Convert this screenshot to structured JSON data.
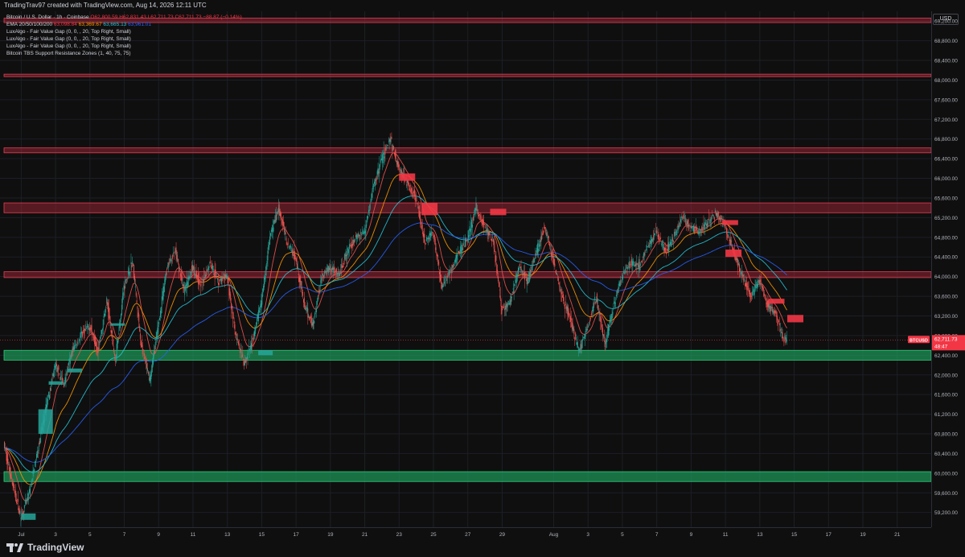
{
  "header": {
    "caption": "TradingTrav97 created with TradingView.com, Aug 14, 2026 12:11 UTC"
  },
  "legend": {
    "symbol_line": {
      "name": "Bitcoin / U.S. Dollar · 1h · Coinbase",
      "ohlc": "O62,800.59  H62,831.43  L62,711.73  C62,711.73  −88.87 (−0.14%)"
    },
    "ema_line": {
      "name": "EMA 20/50/100/200",
      "v20": "63,098.84",
      "v50": "63,369.67",
      "v100": "63,665.13",
      "v200": "63,961.01"
    },
    "indicators": [
      "LuxAlgo - Fair Value Gap (0, 0, , 20, Top Right, Small)",
      "LuxAlgo - Fair Value Gap (0, 0, , 20, Top Right, Small)",
      "LuxAlgo - Fair Value Gap (0, 0, , 20, Top Right, Small)",
      "Bitcoin TBS Support Resistance Zones (1, 40, 75, 75)"
    ]
  },
  "currency_button": "USD",
  "footer": {
    "brand": "TradingView"
  },
  "colors": {
    "background": "#0f0f0f",
    "up": "#26a69a",
    "down": "#ef5350",
    "resistance_zone": "#b2283a",
    "support_zone": "#1e9a5a",
    "ema20": "#ef5350",
    "ema50": "#ff9800",
    "ema100": "#26c6da",
    "ema200": "#2962ff",
    "price_tag": "#f23645"
  },
  "chart_data": {
    "type": "candlestick",
    "symbol": "BTCUSD",
    "timeframe": "1h",
    "ylim": [
      58900,
      69400
    ],
    "y_ticks": [
      "69,200.00",
      "68,800.00",
      "68,400.00",
      "68,000.00",
      "67,600.00",
      "67,200.00",
      "66,800.00",
      "66,400.00",
      "66,000.00",
      "65,600.00",
      "65,200.00",
      "64,800.00",
      "64,400.00",
      "64,000.00",
      "63,600.00",
      "63,200.00",
      "62,800.00",
      "62,400.00",
      "62,000.00",
      "61,600.00",
      "61,200.00",
      "60,800.00",
      "60,400.00",
      "60,000.00",
      "59,600.00",
      "59,200.00"
    ],
    "y_tick_values": [
      69200,
      68800,
      68400,
      68000,
      67600,
      67200,
      66800,
      66400,
      66000,
      65600,
      65200,
      64800,
      64400,
      64000,
      63600,
      63200,
      62800,
      62400,
      62000,
      61600,
      61200,
      60800,
      60400,
      60000,
      59600,
      59200
    ],
    "x_range_days": [
      0,
      52
    ],
    "x_ticks": [
      {
        "label": "Jul",
        "day": 1
      },
      {
        "label": "3",
        "day": 3
      },
      {
        "label": "5",
        "day": 5
      },
      {
        "label": "7",
        "day": 7
      },
      {
        "label": "9",
        "day": 9
      },
      {
        "label": "11",
        "day": 11
      },
      {
        "label": "13",
        "day": 13
      },
      {
        "label": "15",
        "day": 15
      },
      {
        "label": "17",
        "day": 17
      },
      {
        "label": "19",
        "day": 19
      },
      {
        "label": "21",
        "day": 21
      },
      {
        "label": "23",
        "day": 23
      },
      {
        "label": "25",
        "day": 25
      },
      {
        "label": "27",
        "day": 27
      },
      {
        "label": "29",
        "day": 29
      },
      {
        "label": "Aug",
        "day": 32
      },
      {
        "label": "3",
        "day": 34
      },
      {
        "label": "5",
        "day": 36
      },
      {
        "label": "7",
        "day": 38
      },
      {
        "label": "9",
        "day": 40
      },
      {
        "label": "11",
        "day": 42
      },
      {
        "label": "13",
        "day": 44
      },
      {
        "label": "15",
        "day": 46
      },
      {
        "label": "17",
        "day": 48
      },
      {
        "label": "19",
        "day": 50
      },
      {
        "label": "21",
        "day": 52
      }
    ],
    "price_path": [
      {
        "day": 0,
        "p": 60600
      },
      {
        "day": 0.5,
        "p": 59800
      },
      {
        "day": 1,
        "p": 59100
      },
      {
        "day": 1.5,
        "p": 59600
      },
      {
        "day": 2,
        "p": 60500
      },
      {
        "day": 2.5,
        "p": 61400
      },
      {
        "day": 3,
        "p": 62200
      },
      {
        "day": 3.5,
        "p": 61800
      },
      {
        "day": 4,
        "p": 62500
      },
      {
        "day": 4.5,
        "p": 62800
      },
      {
        "day": 5,
        "p": 63000
      },
      {
        "day": 5.5,
        "p": 62500
      },
      {
        "day": 6,
        "p": 63500
      },
      {
        "day": 6.5,
        "p": 62300
      },
      {
        "day": 7,
        "p": 63800
      },
      {
        "day": 7.5,
        "p": 64300
      },
      {
        "day": 8,
        "p": 62600
      },
      {
        "day": 8.5,
        "p": 61900
      },
      {
        "day": 9,
        "p": 63000
      },
      {
        "day": 9.5,
        "p": 64200
      },
      {
        "day": 10,
        "p": 64500
      },
      {
        "day": 10.5,
        "p": 63700
      },
      {
        "day": 11,
        "p": 64200
      },
      {
        "day": 11.5,
        "p": 63800
      },
      {
        "day": 12,
        "p": 64300
      },
      {
        "day": 12.5,
        "p": 63900
      },
      {
        "day": 13,
        "p": 64000
      },
      {
        "day": 13.5,
        "p": 62800
      },
      {
        "day": 14,
        "p": 62200
      },
      {
        "day": 14.5,
        "p": 62700
      },
      {
        "day": 15,
        "p": 63500
      },
      {
        "day": 15.5,
        "p": 64800
      },
      {
        "day": 16,
        "p": 65400
      },
      {
        "day": 16.5,
        "p": 64700
      },
      {
        "day": 17,
        "p": 64400
      },
      {
        "day": 17.5,
        "p": 63400
      },
      {
        "day": 18,
        "p": 63000
      },
      {
        "day": 18.5,
        "p": 64000
      },
      {
        "day": 19,
        "p": 64200
      },
      {
        "day": 19.5,
        "p": 64000
      },
      {
        "day": 20,
        "p": 64500
      },
      {
        "day": 20.5,
        "p": 64800
      },
      {
        "day": 21,
        "p": 64900
      },
      {
        "day": 21.5,
        "p": 65800
      },
      {
        "day": 22,
        "p": 66400
      },
      {
        "day": 22.5,
        "p": 66800
      },
      {
        "day": 23,
        "p": 66200
      },
      {
        "day": 23.5,
        "p": 65900
      },
      {
        "day": 24,
        "p": 65600
      },
      {
        "day": 24.5,
        "p": 64700
      },
      {
        "day": 25,
        "p": 64900
      },
      {
        "day": 25.5,
        "p": 63800
      },
      {
        "day": 26,
        "p": 64100
      },
      {
        "day": 26.5,
        "p": 64500
      },
      {
        "day": 27,
        "p": 64800
      },
      {
        "day": 27.5,
        "p": 65400
      },
      {
        "day": 28,
        "p": 65000
      },
      {
        "day": 28.5,
        "p": 64700
      },
      {
        "day": 29,
        "p": 63300
      },
      {
        "day": 29.5,
        "p": 63500
      },
      {
        "day": 30,
        "p": 64200
      },
      {
        "day": 30.5,
        "p": 63900
      },
      {
        "day": 31,
        "p": 64500
      },
      {
        "day": 31.5,
        "p": 65000
      },
      {
        "day": 32,
        "p": 64300
      },
      {
        "day": 32.5,
        "p": 63600
      },
      {
        "day": 33,
        "p": 63100
      },
      {
        "day": 33.5,
        "p": 62500
      },
      {
        "day": 34,
        "p": 63000
      },
      {
        "day": 34.5,
        "p": 63600
      },
      {
        "day": 35,
        "p": 62600
      },
      {
        "day": 35.5,
        "p": 63400
      },
      {
        "day": 36,
        "p": 64000
      },
      {
        "day": 36.5,
        "p": 64300
      },
      {
        "day": 37,
        "p": 64200
      },
      {
        "day": 37.5,
        "p": 64600
      },
      {
        "day": 38,
        "p": 64900
      },
      {
        "day": 38.5,
        "p": 64500
      },
      {
        "day": 39,
        "p": 64800
      },
      {
        "day": 39.5,
        "p": 65200
      },
      {
        "day": 40,
        "p": 65000
      },
      {
        "day": 40.5,
        "p": 64900
      },
      {
        "day": 41,
        "p": 65100
      },
      {
        "day": 41.5,
        "p": 65300
      },
      {
        "day": 42,
        "p": 65000
      },
      {
        "day": 42.5,
        "p": 64500
      },
      {
        "day": 43,
        "p": 64000
      },
      {
        "day": 43.5,
        "p": 63600
      },
      {
        "day": 44,
        "p": 63900
      },
      {
        "day": 44.5,
        "p": 63400
      },
      {
        "day": 45,
        "p": 63200
      },
      {
        "day": 45.3,
        "p": 62800
      },
      {
        "day": 45.6,
        "p": 62711.73
      }
    ],
    "zones": [
      {
        "kind": "resistance",
        "from": 69170,
        "to": 69260
      },
      {
        "kind": "resistance",
        "from": 68070,
        "to": 68120
      },
      {
        "kind": "resistance",
        "from": 66520,
        "to": 66620
      },
      {
        "kind": "resistance",
        "from": 65300,
        "to": 65500
      },
      {
        "kind": "resistance",
        "from": 63980,
        "to": 64100
      },
      {
        "kind": "support",
        "from": 62300,
        "to": 62500
      },
      {
        "kind": "support",
        "from": 59830,
        "to": 60030
      }
    ],
    "fvg_bear": [
      {
        "day": 23.0,
        "from": 65950,
        "to": 66100
      },
      {
        "day": 24.3,
        "from": 65250,
        "to": 65500
      },
      {
        "day": 28.3,
        "from": 65250,
        "to": 65380
      },
      {
        "day": 41.8,
        "from": 65050,
        "to": 65150
      },
      {
        "day": 42.0,
        "from": 64400,
        "to": 64550
      },
      {
        "day": 44.5,
        "from": 63450,
        "to": 63550
      },
      {
        "day": 45.6,
        "from": 63070,
        "to": 63220
      }
    ],
    "fvg_bull": [
      {
        "day": 1.0,
        "from": 59050,
        "to": 59180
      },
      {
        "day": 2.0,
        "from": 60800,
        "to": 61300
      },
      {
        "day": 2.6,
        "from": 61800,
        "to": 61870
      },
      {
        "day": 3.7,
        "from": 62050,
        "to": 62130
      },
      {
        "day": 6.2,
        "from": 63000,
        "to": 63050
      },
      {
        "day": 14.8,
        "from": 62400,
        "to": 62500
      }
    ],
    "last_price": {
      "label": "BTCUSD",
      "value": "62,711.73",
      "countdown": "48:47",
      "p": 62711.73
    }
  }
}
